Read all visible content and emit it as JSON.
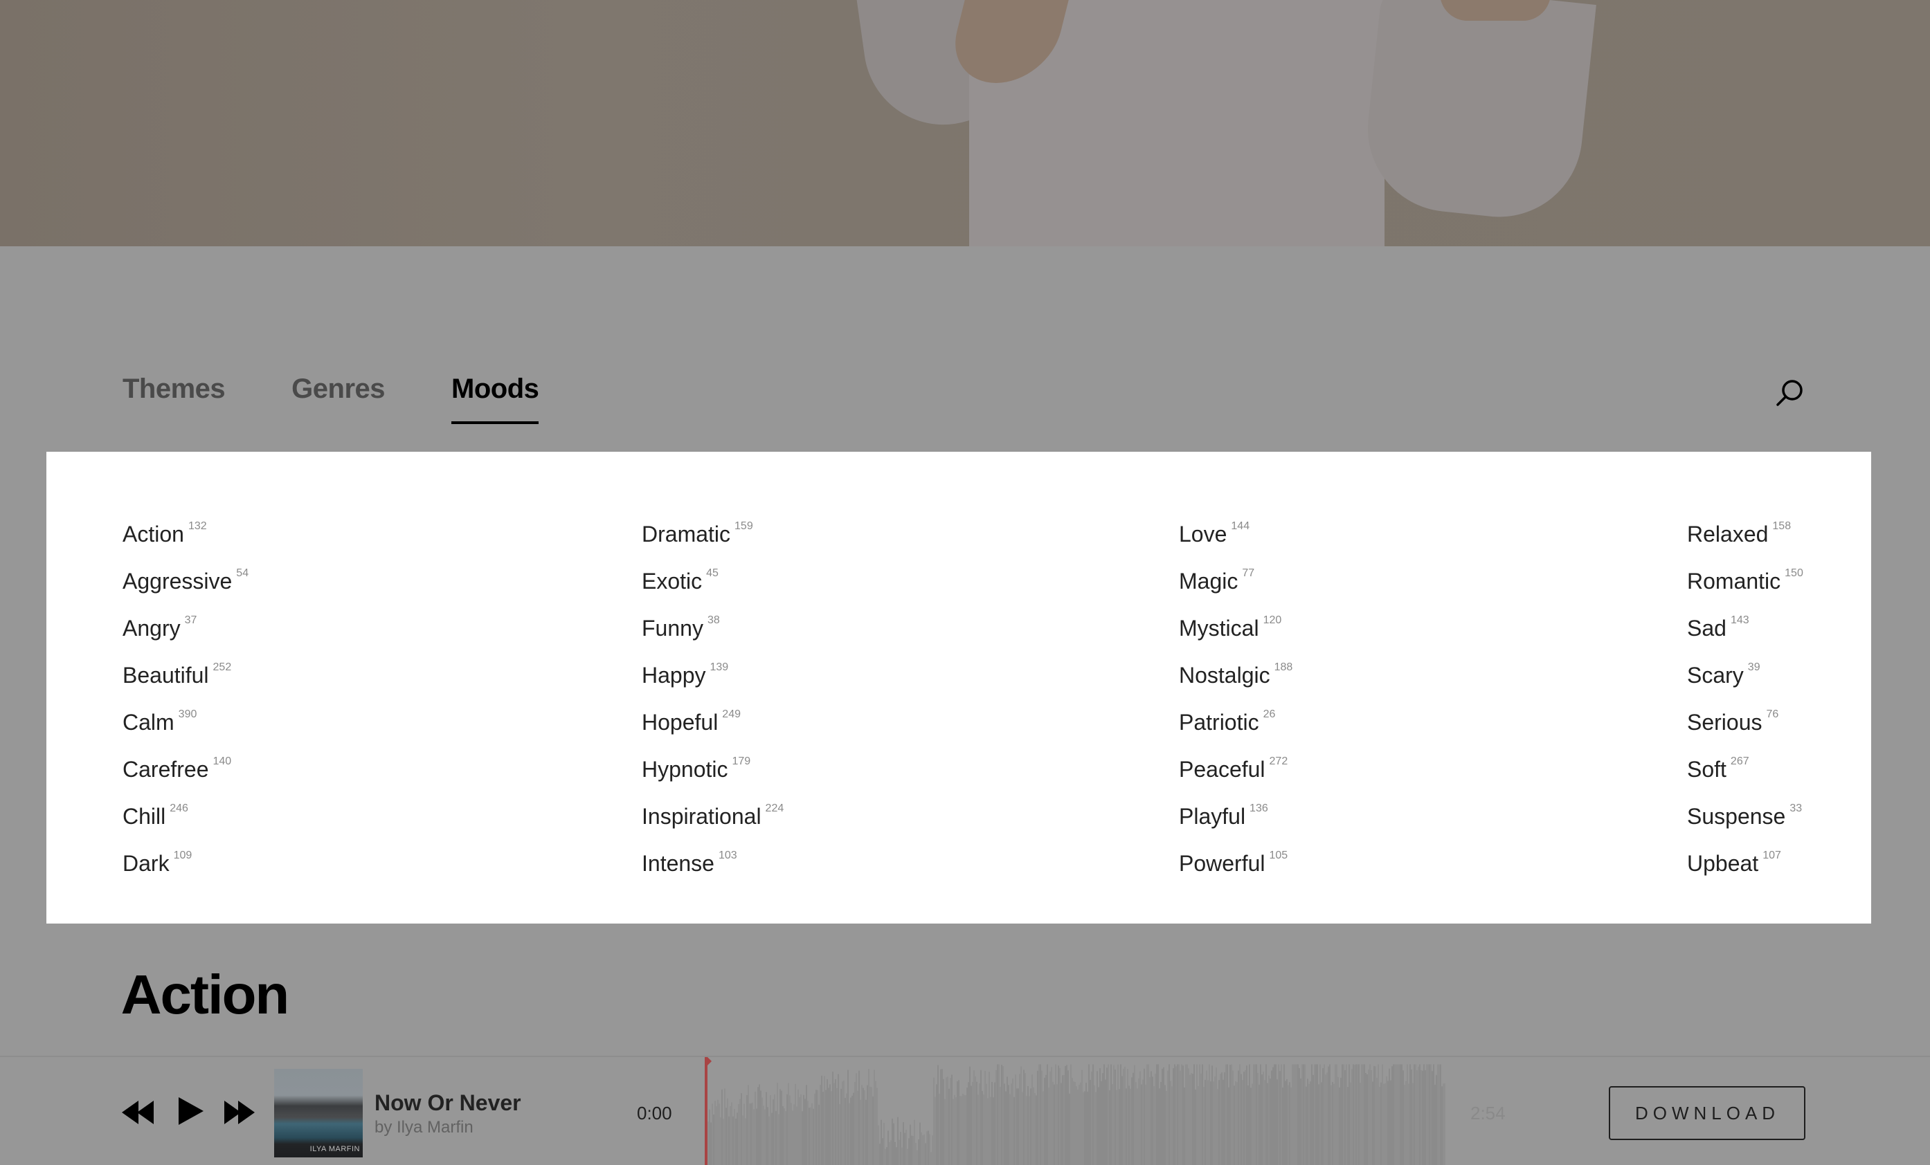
{
  "tabs": [
    {
      "label": "Themes",
      "active": false
    },
    {
      "label": "Genres",
      "active": false
    },
    {
      "label": "Moods",
      "active": true
    }
  ],
  "search_icon": "search-icon",
  "moods": {
    "columns": [
      [
        {
          "label": "Action",
          "count": "132"
        },
        {
          "label": "Aggressive",
          "count": "54"
        },
        {
          "label": "Angry",
          "count": "37"
        },
        {
          "label": "Beautiful",
          "count": "252"
        },
        {
          "label": "Calm",
          "count": "390"
        },
        {
          "label": "Carefree",
          "count": "140"
        },
        {
          "label": "Chill",
          "count": "246"
        },
        {
          "label": "Dark",
          "count": "109"
        }
      ],
      [
        {
          "label": "Dramatic",
          "count": "159"
        },
        {
          "label": "Exotic",
          "count": "45"
        },
        {
          "label": "Funny",
          "count": "38"
        },
        {
          "label": "Happy",
          "count": "139"
        },
        {
          "label": "Hopeful",
          "count": "249"
        },
        {
          "label": "Hypnotic",
          "count": "179"
        },
        {
          "label": "Inspirational",
          "count": "224"
        },
        {
          "label": "Intense",
          "count": "103"
        }
      ],
      [
        {
          "label": "Love",
          "count": "144"
        },
        {
          "label": "Magic",
          "count": "77"
        },
        {
          "label": "Mystical",
          "count": "120"
        },
        {
          "label": "Nostalgic",
          "count": "188"
        },
        {
          "label": "Patriotic",
          "count": "26"
        },
        {
          "label": "Peaceful",
          "count": "272"
        },
        {
          "label": "Playful",
          "count": "136"
        },
        {
          "label": "Powerful",
          "count": "105"
        }
      ],
      [
        {
          "label": "Relaxed",
          "count": "158"
        },
        {
          "label": "Romantic",
          "count": "150"
        },
        {
          "label": "Sad",
          "count": "143"
        },
        {
          "label": "Scary",
          "count": "39"
        },
        {
          "label": "Serious",
          "count": "76"
        },
        {
          "label": "Soft",
          "count": "267"
        },
        {
          "label": "Suspense",
          "count": "33"
        },
        {
          "label": "Upbeat",
          "count": "107"
        }
      ]
    ]
  },
  "section": {
    "title": "Action"
  },
  "player": {
    "controls": [
      "rewind-icon",
      "play-icon",
      "fast-forward-icon"
    ],
    "cover_label": "ILYA MARFIN",
    "track_title": "Now Or Never",
    "track_artist": "by Ilya Marfin",
    "time_current": "0:00",
    "time_total": "2:54",
    "progress": 0,
    "download_label": "DOWNLOAD",
    "playhead_color": "#a84444"
  }
}
